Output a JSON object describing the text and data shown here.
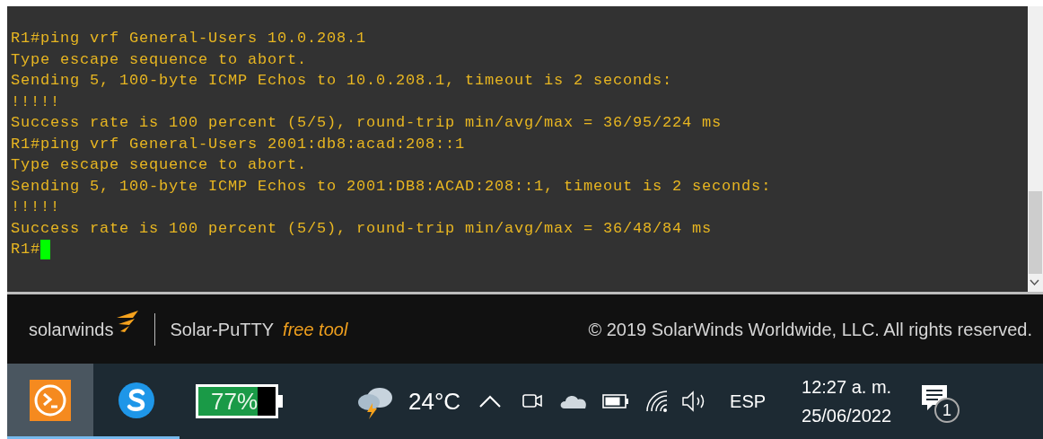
{
  "terminal": {
    "lines": [
      "R1#ping vrf General-Users 10.0.208.1",
      "Type escape sequence to abort.",
      "Sending 5, 100-byte ICMP Echos to 10.0.208.1, timeout is 2 seconds:",
      "!!!!!",
      "Success rate is 100 percent (5/5), round-trip min/avg/max = 36/95/224 ms",
      "R1#ping vrf General-Users 2001:db8:acad:208::1",
      "Type escape sequence to abort.",
      "Sending 5, 100-byte ICMP Echos to 2001:DB8:ACAD:208::1, timeout is 2 seconds:",
      "!!!!!",
      "Success rate is 100 percent (5/5), round-trip min/avg/max = 36/48/84 ms"
    ],
    "prompt": "R1#"
  },
  "footer": {
    "brand": "solarwinds",
    "product": "Solar-PuTTY",
    "tagline": "free tool",
    "copyright": "© 2019 SolarWinds Worldwide, LLC. All rights reserved."
  },
  "taskbar": {
    "apps": [
      {
        "kind": "terminal",
        "selected": true
      },
      {
        "kind": "skype",
        "selected": false
      }
    ],
    "battery_widget": {
      "reading": "77%",
      "level": 0.77
    },
    "weather": {
      "temperature": "24°C"
    },
    "language": "ESP",
    "time": "12:27 a. m.",
    "date": "25/06/2022",
    "notifications": "1"
  }
}
